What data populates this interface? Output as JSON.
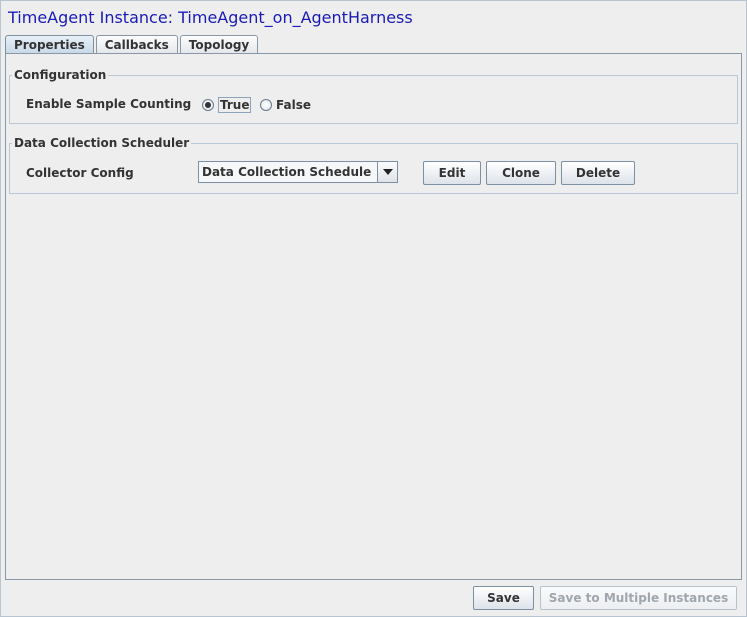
{
  "window": {
    "title": "TimeAgent Instance: TimeAgent_on_AgentHarness"
  },
  "tabs": [
    {
      "label": "Properties",
      "active": true
    },
    {
      "label": "Callbacks",
      "active": false
    },
    {
      "label": "Topology",
      "active": false
    }
  ],
  "configuration": {
    "legend": "Configuration",
    "sample_counting_label": "Enable Sample Counting",
    "options": [
      {
        "label": "True",
        "selected": true
      },
      {
        "label": "False",
        "selected": false
      }
    ]
  },
  "scheduler": {
    "legend": "Data Collection Scheduler",
    "collector_label": "Collector Config",
    "collector_value": "Data Collection Schedule",
    "edit_label": "Edit",
    "clone_label": "Clone",
    "delete_label": "Delete"
  },
  "footer": {
    "save_label": "Save",
    "save_multiple_label": "Save to Multiple Instances",
    "save_multiple_enabled": false
  },
  "colors": {
    "title": "#1a1ab8",
    "background": "#eeeeee",
    "border": "#8a97a6"
  },
  "icons": {
    "radio_selected": "radio-selected-icon",
    "radio_unselected": "radio-unselected-icon",
    "dropdown": "chevron-down-icon"
  }
}
